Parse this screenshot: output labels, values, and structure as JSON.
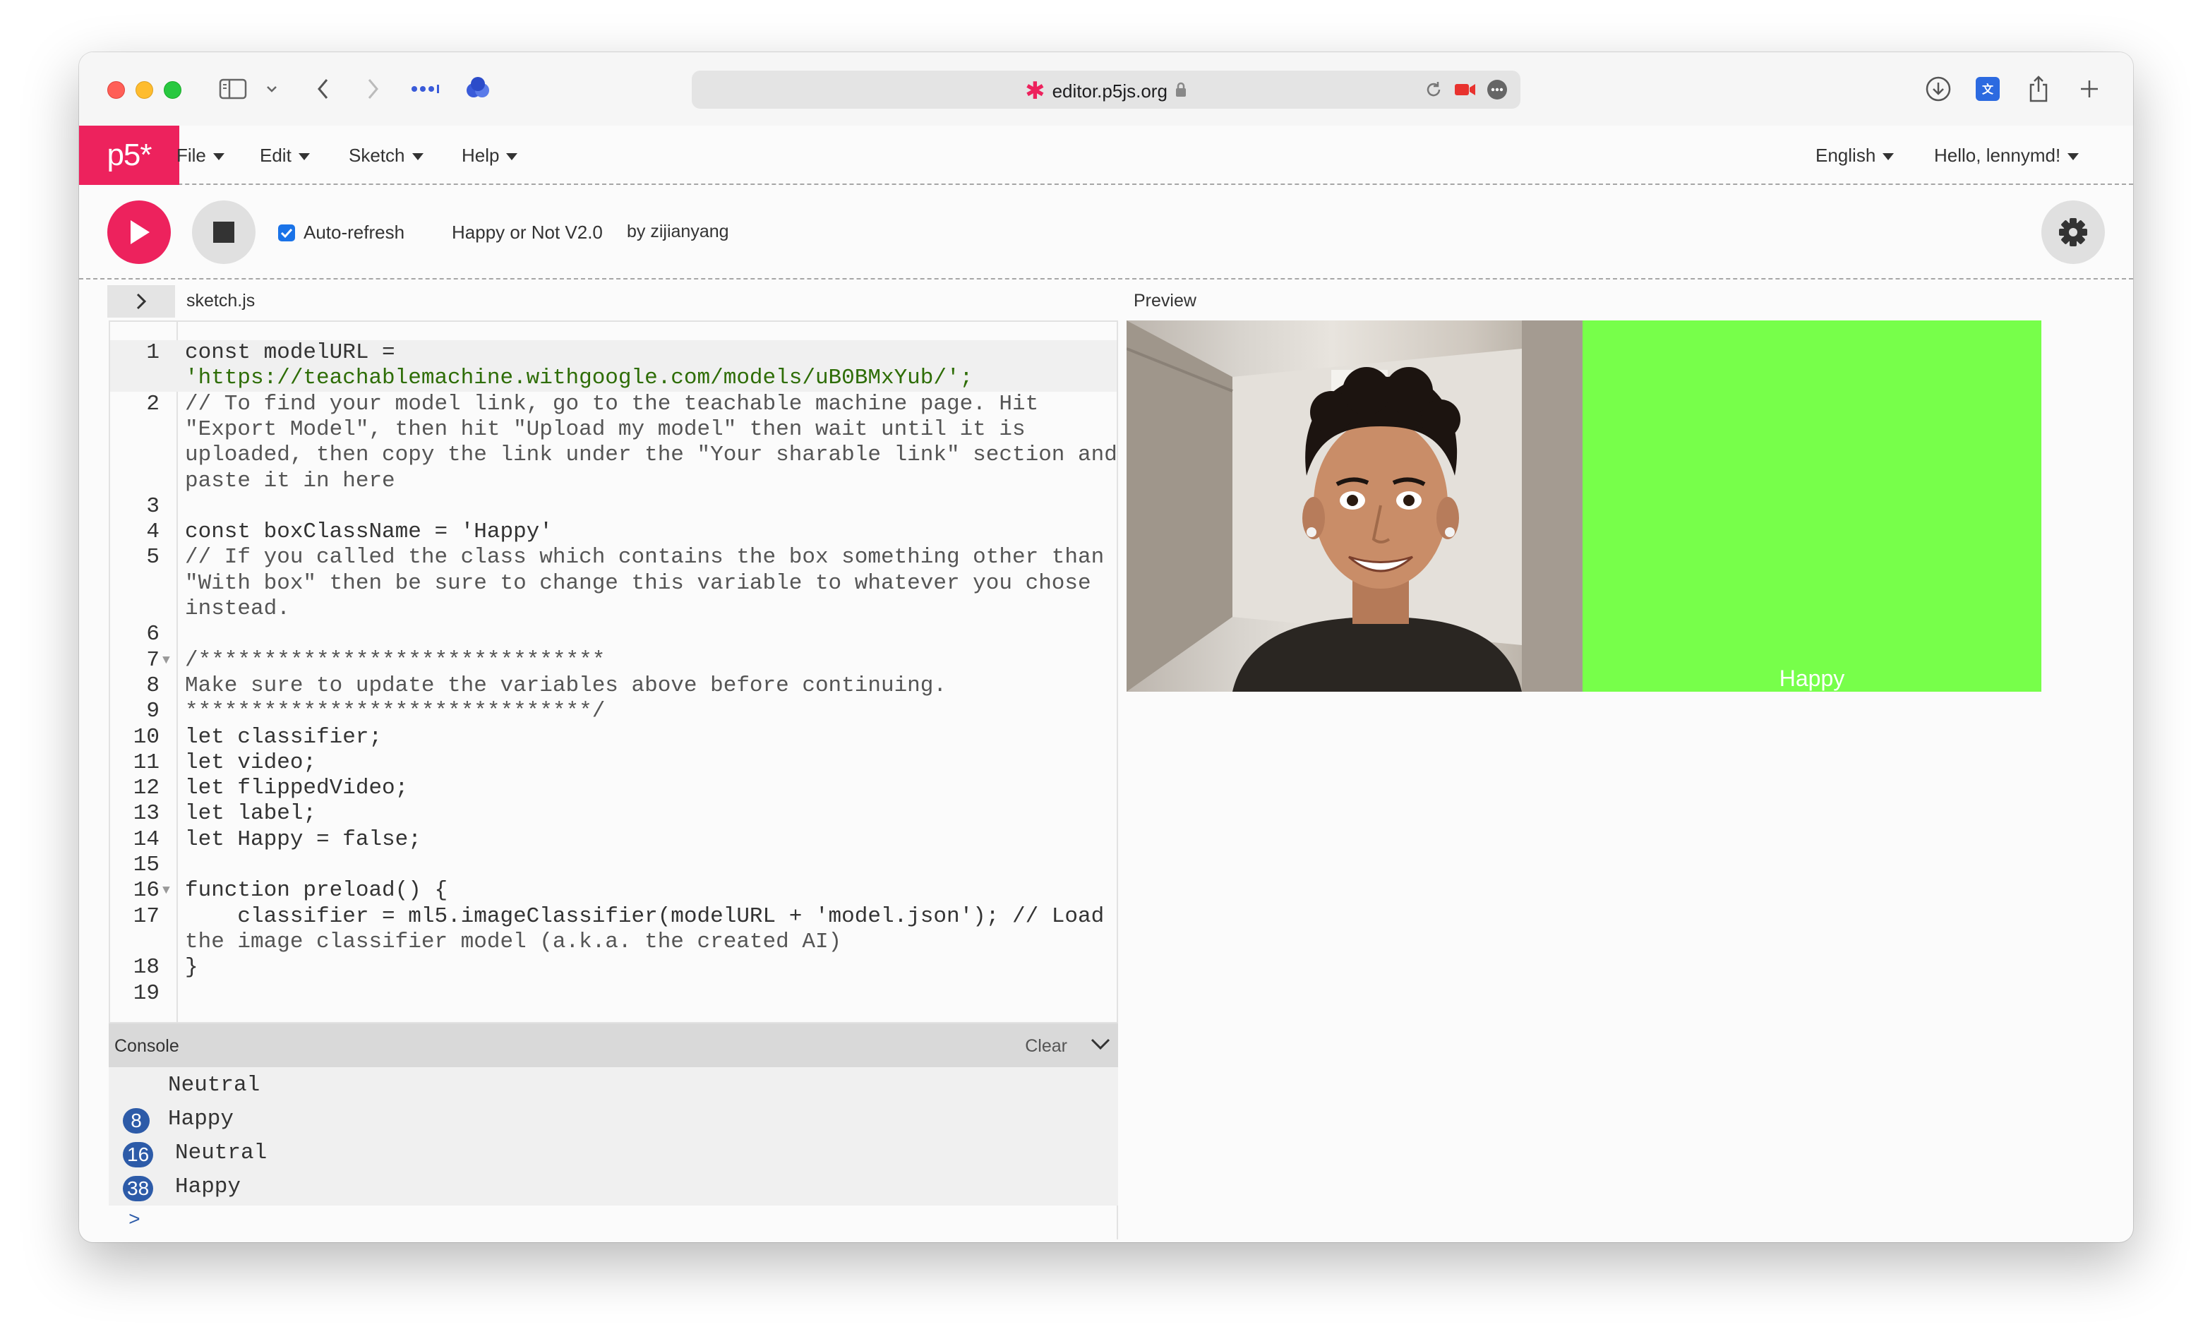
{
  "browser": {
    "address": "editor.p5js.org"
  },
  "app": {
    "logo": "p5*",
    "menus": [
      "File",
      "Edit",
      "Sketch",
      "Help"
    ],
    "language": "English",
    "user_greeting": "Hello, lennymd!"
  },
  "toolbar": {
    "auto_refresh_label": "Auto-refresh",
    "auto_refresh_checked": true,
    "sketch_name": "Happy or Not V2.0",
    "sketch_author": "by zijianyang"
  },
  "editor": {
    "file_name": "sketch.js",
    "lines": [
      {
        "n": "1",
        "text": "const modelURL ="
      },
      {
        "n": "",
        "text": "'https://teachablemachine.withgoogle.com/models/uB0BMxYub/';"
      },
      {
        "n": "2",
        "text": "// To find your model link, go to the teachable machine page. Hit"
      },
      {
        "n": "",
        "text": "\"Export Model\", then hit \"Upload my model\" then wait until it is"
      },
      {
        "n": "",
        "text": "uploaded, then copy the link under the \"Your sharable link\" section and"
      },
      {
        "n": "",
        "text": "paste it in here"
      },
      {
        "n": "3",
        "text": ""
      },
      {
        "n": "4",
        "text": "const boxClassName = 'Happy'"
      },
      {
        "n": "5",
        "text": "// If you called the class which contains the box something other than"
      },
      {
        "n": "",
        "text": "\"With box\" then be sure to change this variable to whatever you chose"
      },
      {
        "n": "",
        "text": "instead."
      },
      {
        "n": "6",
        "text": ""
      },
      {
        "n": "7",
        "text": "/*******************************"
      },
      {
        "n": "8",
        "text": "Make sure to update the variables above before continuing."
      },
      {
        "n": "9",
        "text": "*******************************/"
      },
      {
        "n": "10",
        "text": "let classifier;"
      },
      {
        "n": "11",
        "text": "let video;"
      },
      {
        "n": "12",
        "text": "let flippedVideo;"
      },
      {
        "n": "13",
        "text": "let label;"
      },
      {
        "n": "14",
        "text": "let Happy = false;"
      },
      {
        "n": "15",
        "text": ""
      },
      {
        "n": "16",
        "text": "function preload() {"
      },
      {
        "n": "17",
        "text": "    classifier = ml5.imageClassifier(modelURL + 'model.json'); // Load"
      },
      {
        "n": "",
        "text": "the image classifier model (a.k.a. the created AI)"
      },
      {
        "n": "18",
        "text": "}"
      },
      {
        "n": "19",
        "text": ""
      }
    ]
  },
  "console": {
    "title": "Console",
    "clear_label": "Clear",
    "entries": [
      {
        "count": "",
        "message": "Neutral"
      },
      {
        "count": "8",
        "message": "Happy"
      },
      {
        "count": "16",
        "message": "Neutral"
      },
      {
        "count": "38",
        "message": "Happy"
      }
    ],
    "prompt": ">"
  },
  "preview": {
    "label": "Preview",
    "box_label": "Happy",
    "box_color": "#77ff4a"
  },
  "colors": {
    "accent": "#ed225d",
    "badge": "#2d5ba8"
  }
}
